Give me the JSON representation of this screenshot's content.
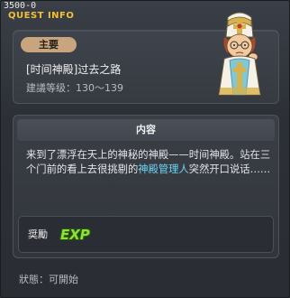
{
  "window": {
    "quest_id": "3500-0",
    "title": "QUEST INFO"
  },
  "info": {
    "category": "主要",
    "quest_name": "[时间神殿]过去之路",
    "level_requirement": "建議等级：130～139",
    "npc_icon": "bishop-npc-portrait"
  },
  "content": {
    "header": "内容",
    "text_before": "来到了漂浮在天上的神秘的神殿——时间神殿。站在三个门前的看上去很挑剔的",
    "npc_name": "神殿管理人",
    "text_after": "突然开口说话……"
  },
  "reward": {
    "label": "奨勵",
    "exp_label": "EXP"
  },
  "status": {
    "text": "狀態：可開始"
  },
  "colors": {
    "title": "#f2c230",
    "badge": "#c9a57f",
    "highlight": "#6fd7f7",
    "exp": "#8be23a"
  }
}
